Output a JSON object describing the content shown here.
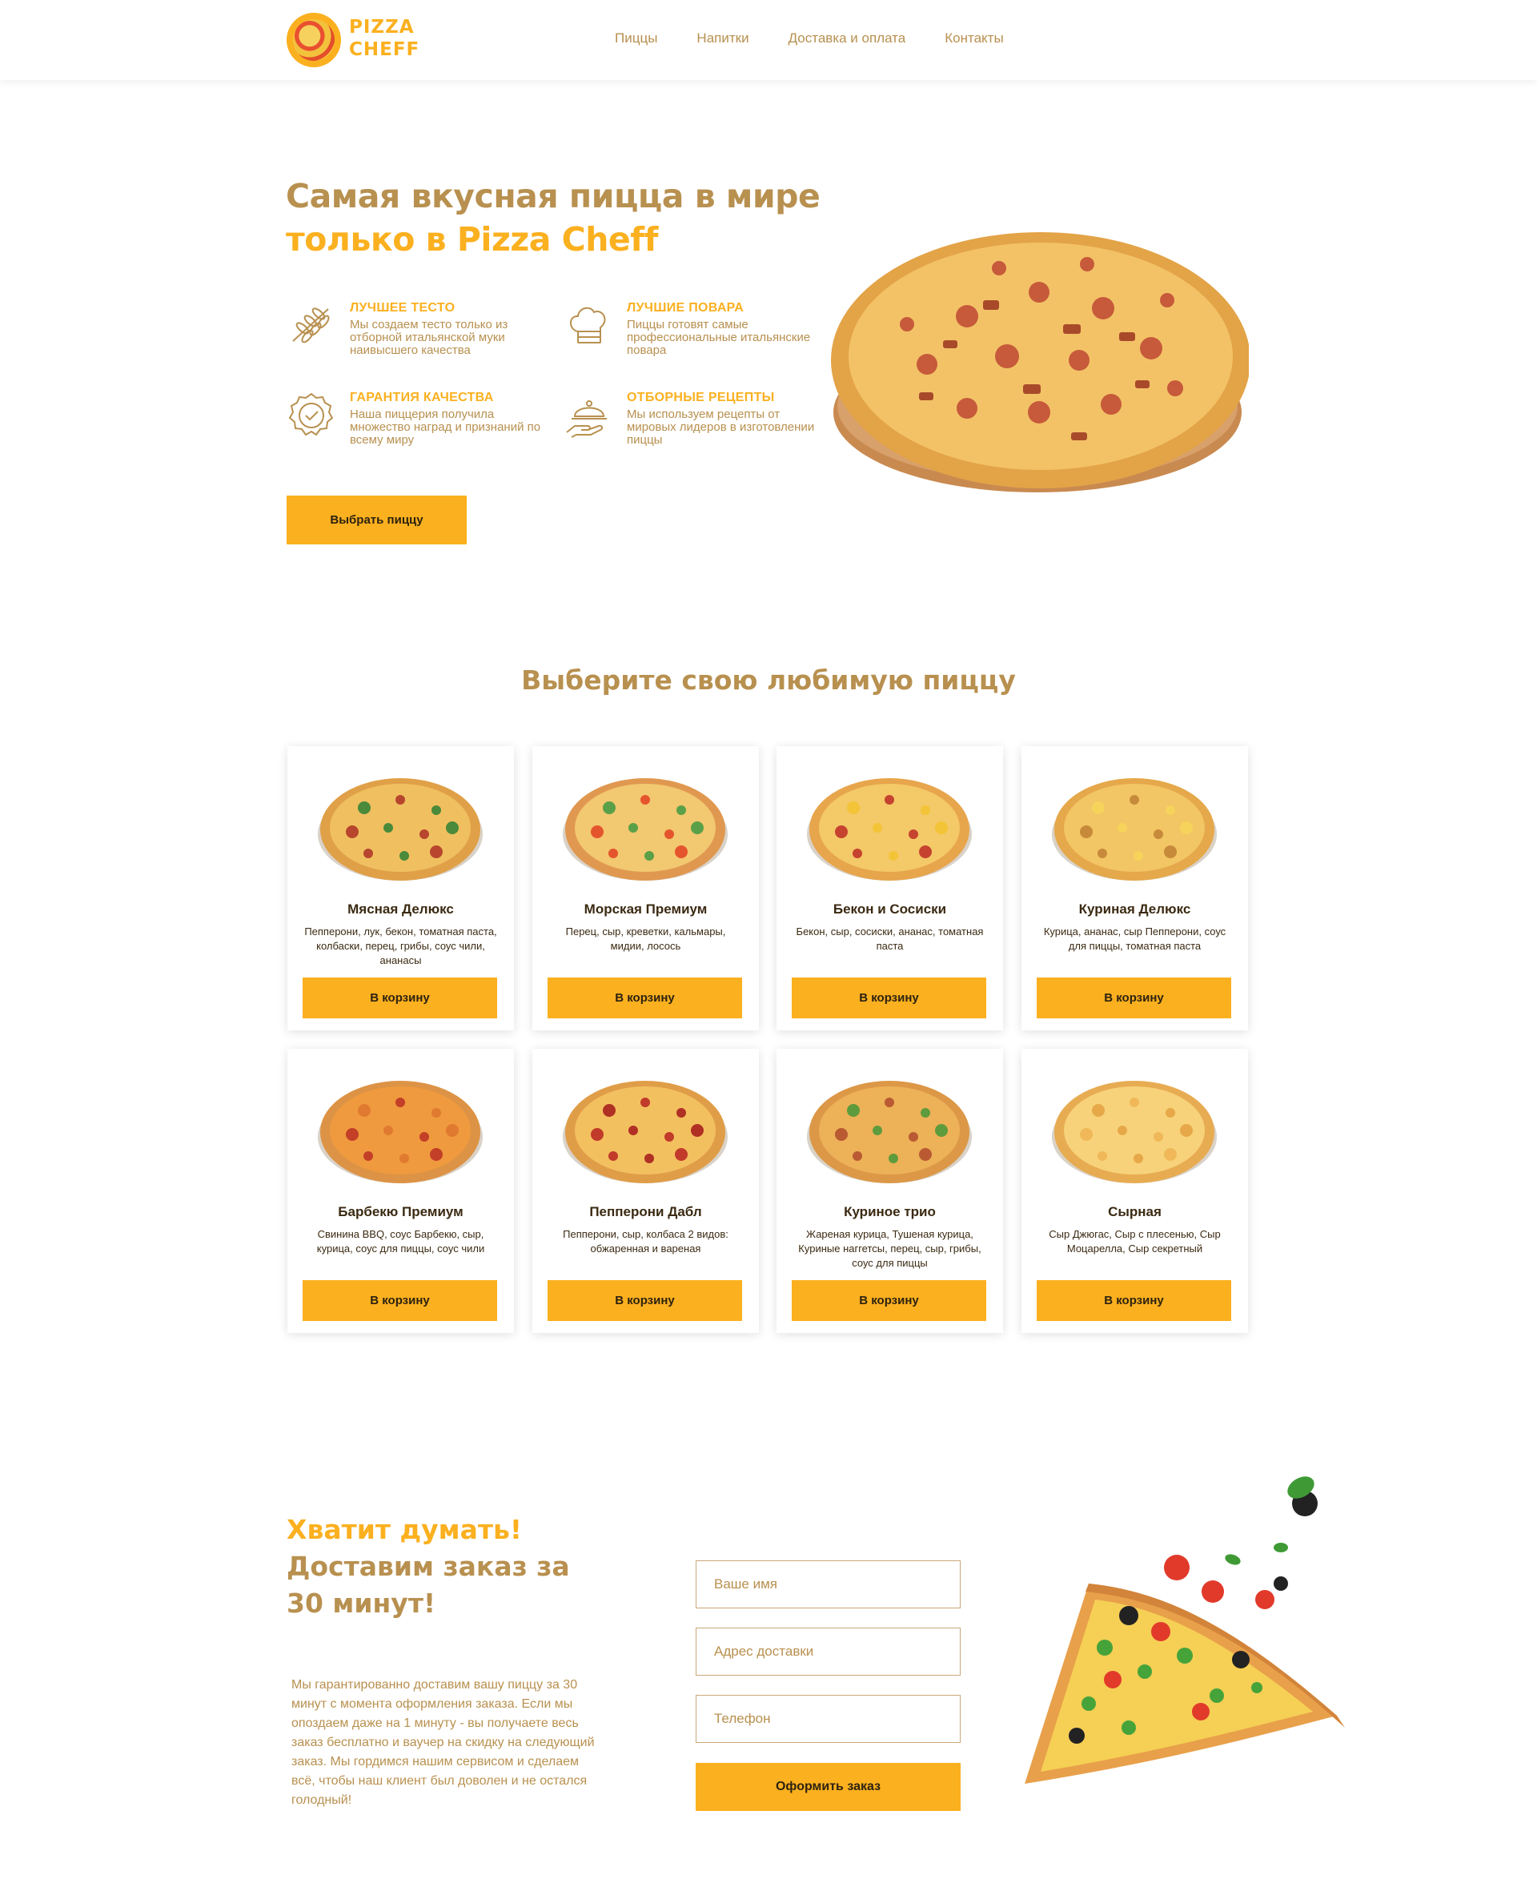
{
  "header": {
    "logo_line1": "PIZZA",
    "logo_line2": "CHEFF",
    "nav": [
      "Пиццы",
      "Напитки",
      "Доставка и оплата",
      "Контакты"
    ]
  },
  "hero": {
    "title_line1": "Самая вкусная пицца в мире",
    "title_line2": "только в Pizza Cheff",
    "features": [
      {
        "icon": "wheat-icon",
        "title": "Лучшее тесто",
        "text": "Мы создаем тесто только из отборной итальянской муки наивысшего качества"
      },
      {
        "icon": "chef-hat-icon",
        "title": "Лучшие повара",
        "text": "Пиццы готовят самые профессиональные итальянские повара"
      },
      {
        "icon": "quality-badge-icon",
        "title": "Гарантия качества",
        "text": "Наша пиццерия получила множество наград и признаний по всему миру"
      },
      {
        "icon": "cloche-icon",
        "title": "Отборные рецепты",
        "text": "Мы используем рецепты от мировых лидеров в изготовлении пиццы"
      }
    ],
    "cta": "Выбрать пиццу"
  },
  "menu": {
    "title": "Выберите свою любимую пиццу",
    "add_label": "В корзину",
    "pizzas": [
      {
        "name": "Мясная Делюкс",
        "desc": "Пепперони, лук, бекон, томатная паста, колбаски, перец, грибы, соус чили, ананасы"
      },
      {
        "name": "Морская Премиум",
        "desc": "Перец, сыр, креветки, кальмары, мидии, лосось"
      },
      {
        "name": "Бекон и Сосиски",
        "desc": "Бекон, сыр, сосиски, ананас, томатная паста"
      },
      {
        "name": "Куриная Делюкс",
        "desc": "Курица, ананас, сыр Пепперони, соус для пиццы, томатная паста"
      },
      {
        "name": "Барбекю Премиум",
        "desc": "Свинина BBQ, соус Барбекю, сыр, курица, соус для пиццы, соус чили"
      },
      {
        "name": "Пепперони Дабл",
        "desc": "Пепперони, сыр, колбаса 2 видов: обжаренная и вареная"
      },
      {
        "name": "Куриное трио",
        "desc": "Жареная курица, Тушеная курица, Куриные наггетсы, перец, сыр, грибы, соус для пиццы"
      },
      {
        "name": "Сырная",
        "desc": "Сыр Джюгас, Сыр с плесенью, Сыр Моцарелла, Сыр секретный"
      }
    ]
  },
  "order": {
    "title_line1": "Хватит думать!",
    "title_line2": "Доставим заказ за 30 минут!",
    "text": "Мы  гарантированно доставим вашу пиццу за 30 минут с момента оформления заказа. Если мы опоздаем даже на 1 минуту - вы получаете весь заказ бесплатно и ваучер на скидку на следующий заказ. Мы гордимся нашим сервисом и сделаем всё, чтобы наш клиент был доволен и не остался голодный!",
    "name_placeholder": "Ваше имя",
    "address_placeholder": "Адрес доставки",
    "phone_placeholder": "Телефон",
    "submit": "Оформить заказ"
  },
  "colors": {
    "accent": "#fbb01f",
    "brown": "#b8904f",
    "dark": "#3b2a12"
  }
}
